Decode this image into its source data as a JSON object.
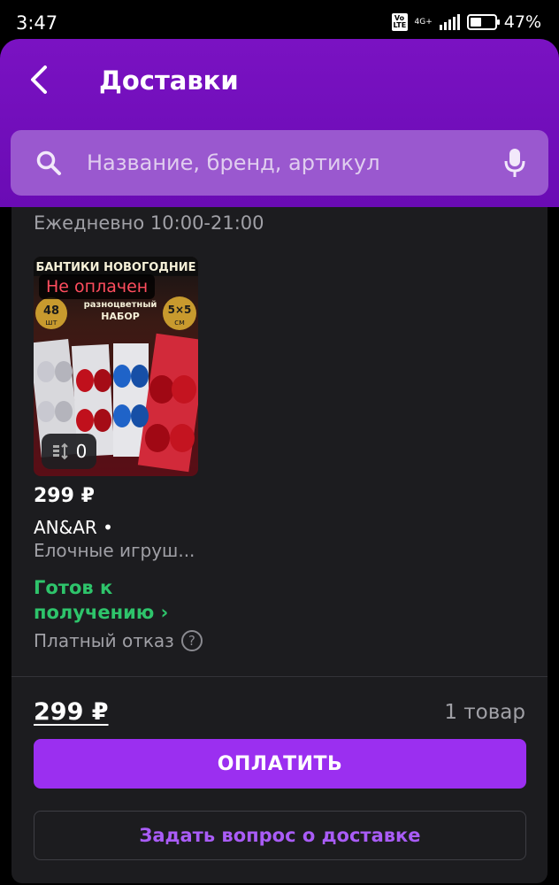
{
  "status_bar": {
    "time": "3:47",
    "volte": "Vo LTE",
    "network": "4G+",
    "battery_level": 0.47,
    "battery_text": "47%"
  },
  "header": {
    "title": "Доставки",
    "back_icon": "chevron-left-icon"
  },
  "search": {
    "placeholder": "Название, бренд, артикул",
    "search_icon": "search-icon",
    "mic_icon": "microphone-icon"
  },
  "delivery": {
    "hours": "Ежедневно 10:00-21:00",
    "product": {
      "badge": "Не оплачен",
      "image_lines": [
        "БАНТИКИ НОВОГОДНИЕ",
        "разноцветный",
        "НАБОР",
        "48",
        "шт",
        "5×5",
        "см"
      ],
      "return_count": "0",
      "price": "299 ₽",
      "brand": "AN&AR •",
      "category": "Елочные игруш...",
      "status_line1": "Готов к",
      "status_line2": "получению ›",
      "refusal": "Платный отказ",
      "help_icon_glyph": "?"
    },
    "total_price": "299 ₽",
    "item_count": "1 товар",
    "pay_label": "ОПЛАТИТЬ",
    "ask_label": "Задать вопрос о доставке"
  },
  "colors": {
    "header": "#6a0bb4",
    "search": "#9a58cf",
    "card": "#1c1c1f",
    "pay_button": "#9b2ff0",
    "ready_status": "#2ec46b",
    "not_paid": "#ff4d5e",
    "ask_text": "#a95cf7"
  }
}
